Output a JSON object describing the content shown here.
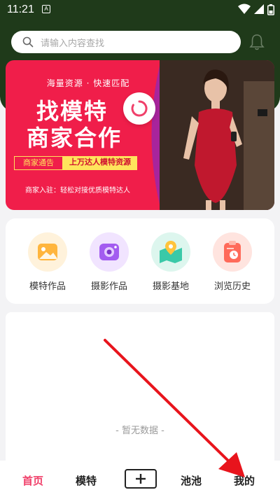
{
  "status_bar": {
    "time": "11:21",
    "notification_letter": "A"
  },
  "search": {
    "placeholder": "请输入内容查找"
  },
  "banner": {
    "tagline": "海量资源 · 快速匹配",
    "title_line1": "找模特",
    "title_line2": "商家合作",
    "pill_left": "商家通告",
    "pill_right": "上万达人模特资源",
    "subtitle": "商家入驻：轻松对接优质模特达人"
  },
  "categories": [
    {
      "label": "模特作品",
      "icon": "image-icon",
      "color": "#ffb53d"
    },
    {
      "label": "摄影作品",
      "icon": "camera-icon",
      "color": "#a35cf0"
    },
    {
      "label": "摄影基地",
      "icon": "map-pin-icon",
      "color": "#3ac9a8"
    },
    {
      "label": "浏览历史",
      "icon": "clipboard-clock-icon",
      "color": "#ff6a5a"
    }
  ],
  "content": {
    "empty_text": "- 暂无数据 -"
  },
  "tabbar": {
    "home": "首页",
    "models": "模特",
    "pool": "池池",
    "mine": "我的"
  },
  "colors": {
    "accent": "#f0406a",
    "header": "#1f3a1a",
    "banner": "#f01e4a",
    "annotation_arrow": "#e8141c"
  }
}
